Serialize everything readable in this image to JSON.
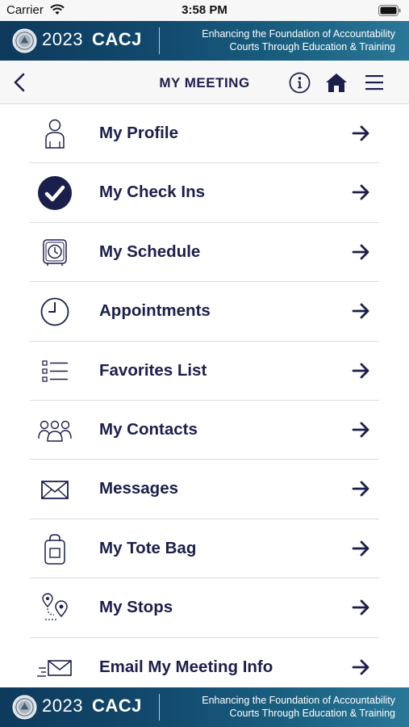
{
  "status": {
    "carrier": "Carrier",
    "time": "3:58 PM"
  },
  "banner": {
    "year": "2023",
    "acronym": "CACJ",
    "tagline_1": "Enhancing the Foundation of Accountability",
    "tagline_2": "Courts Through Education & Training"
  },
  "nav": {
    "title": "MY MEETING"
  },
  "menu": {
    "items": [
      {
        "label": "My Profile",
        "icon": "person-icon"
      },
      {
        "label": "My Check Ins",
        "icon": "checkmark-circle-icon"
      },
      {
        "label": "My Schedule",
        "icon": "clock-schedule-icon"
      },
      {
        "label": "Appointments",
        "icon": "clock-icon"
      },
      {
        "label": "Favorites List",
        "icon": "checklist-icon"
      },
      {
        "label": "My Contacts",
        "icon": "group-icon"
      },
      {
        "label": "Messages",
        "icon": "envelope-icon"
      },
      {
        "label": "My Tote Bag",
        "icon": "tote-bag-icon"
      },
      {
        "label": "My Stops",
        "icon": "map-pins-icon"
      },
      {
        "label": "Email My Meeting Info",
        "icon": "send-mail-icon"
      }
    ]
  },
  "colors": {
    "accent": "#1b1f4b",
    "banner": "#124a6e"
  }
}
